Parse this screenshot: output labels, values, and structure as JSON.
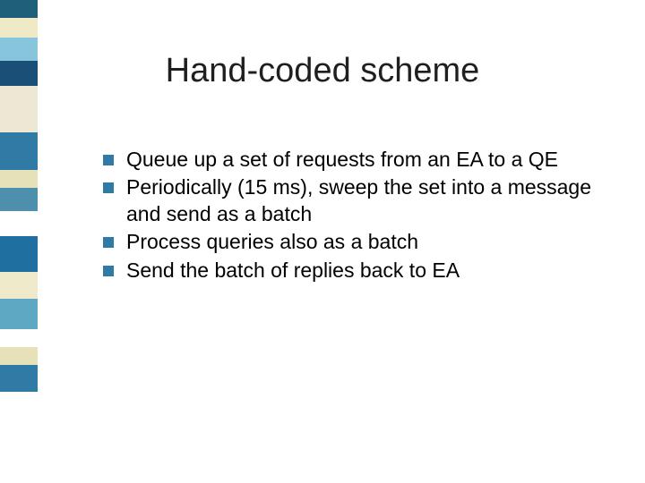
{
  "title": "Hand-coded scheme",
  "bullets": {
    "b0": "Queue up a set of requests from an EA to a QE",
    "b1": "Periodically (15 ms), sweep the set into a message and send as a batch",
    "b2": "Process queries also as a batch",
    "b3": "Send the batch of replies back to EA"
  },
  "sidebar_colors": {
    "c0": "#1f5f7a",
    "h0": 20,
    "c1": "#f0e9c6",
    "h1": 22,
    "c2": "#86c5dc",
    "h2": 26,
    "c3": "#1a4f78",
    "h3": 28,
    "c4": "#ece8d4",
    "h4": 52,
    "c5": "#2f7ba6",
    "h5": 42,
    "c6": "#e6e1b8",
    "h6": 20,
    "c7": "#4d8fad",
    "h7": 26,
    "c8": "#ffffff",
    "h8": 28,
    "c9": "#1f6fa0",
    "h9": 40,
    "c10": "#efeac9",
    "h10": 30,
    "c11": "#5fa8c4",
    "h11": 34,
    "c12": "#ffffff",
    "h12": 20,
    "c13": "#e6e1b8",
    "h13": 20,
    "c14": "#2f7ba6",
    "h14": 30,
    "c15": "#ffffff",
    "h15": 102
  }
}
